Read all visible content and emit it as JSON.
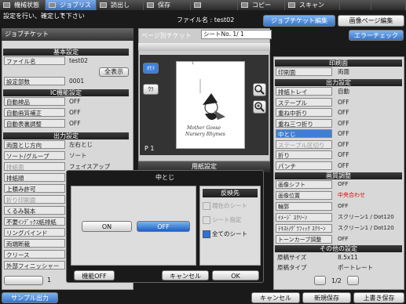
{
  "tabs": [
    "機械状態",
    "ジョブリスト",
    "読出し",
    "保存",
    "コピー",
    "スキャン"
  ],
  "status_line": "設定を行い、確定して下さい",
  "file_label": "ファイル名 : test02",
  "left": {
    "title": "ジョブチケット",
    "basic_hdr": "基本設定",
    "file_name_label": "ファイル名",
    "file_name_value": "test02",
    "show_all": "全表示",
    "copies_label": "設定部数",
    "copies_value": "0001",
    "ic_hdr": "IC機能設定",
    "ic_rows": [
      {
        "l": "自動検品",
        "v": "OFF"
      },
      {
        "l": "自動画質補正",
        "v": "OFF"
      },
      {
        "l": "自動表裏調整",
        "v": "OFF"
      }
    ],
    "out_hdr": "出力設定",
    "out_rows": [
      {
        "l": "両面とじ方向",
        "v": "左右とじ"
      },
      {
        "l": "ソート/グループ",
        "v": "ソート"
      },
      {
        "l": "排紙面",
        "v": "フェイスアップ"
      },
      {
        "l": "排紙順",
        "v": ""
      },
      {
        "l": "上積み許可",
        "v": ""
      },
      {
        "l": "折り印刷面",
        "v": ""
      },
      {
        "l": "くるみ製本",
        "v": ""
      },
      {
        "l": "不要ｲﾝﾃﾞｯｸｽ紙排紙",
        "v": ""
      },
      {
        "l": "リングバインド",
        "v": ""
      },
      {
        "l": "両端断裁",
        "v": ""
      },
      {
        "l": "クリース",
        "v": ""
      },
      {
        "l": "外部フィニッシャー",
        "v": ""
      }
    ],
    "page": "1"
  },
  "mid": {
    "title": "ページ別チケット",
    "sheet_label": "シートNo.",
    "sheet_value": "1/  1",
    "omote": "ｵﾓﾃ",
    "ura": "ｳﾗ",
    "page_label": "P 1",
    "paper_hdr": "用紙設定",
    "doc_line1": "Mother Goose",
    "doc_line2": "Nursery Rhymes",
    "doc_num": "1"
  },
  "right": {
    "error_check": "エラーチェック",
    "print_hdr": "印刷面",
    "print_l": "印刷面",
    "print_v": "両面",
    "out_hdr": "出力設定",
    "out_rows": [
      {
        "l": "排紙トレイ",
        "v": "自動",
        "s": ""
      },
      {
        "l": "ステープル",
        "v": "OFF",
        "s": ""
      },
      {
        "l": "重ね中折り",
        "v": "OFF",
        "s": ""
      },
      {
        "l": "重ね三つ折り",
        "v": "OFF",
        "s": ""
      },
      {
        "l": "中とじ",
        "v": "OFF",
        "s": "blue"
      },
      {
        "l": "ステープル区切り",
        "v": "OFF",
        "s": "dis"
      },
      {
        "l": "折り",
        "v": "OFF",
        "s": ""
      },
      {
        "l": "パンチ",
        "v": "OFF",
        "s": ""
      }
    ],
    "img_hdr": "画質調整",
    "img_rows": [
      {
        "l": "画像シフト",
        "v": "OFF",
        "r": false
      },
      {
        "l": "画像位置",
        "v": "中央合わせ",
        "r": true
      },
      {
        "l": "輪郭",
        "v": "OFF",
        "r": false
      },
      {
        "l": "ｲﾒｰｼﾞ ｽｸﾘｰﾝ",
        "v": "スクリーン1 / Dot120",
        "r": false
      },
      {
        "l": "ﾃｷｽﾄ/ｸﾞﾗﾌｨｯｸ ｽｸﾘｰﾝ",
        "v": "スクリーン1 / Dot120",
        "r": false
      },
      {
        "l": "トーンカーブ調整",
        "v": "OFF",
        "r": false
      }
    ],
    "other_hdr": "その他の設定",
    "other_rows": [
      {
        "l": "原稿サイズ",
        "v": "8.5x11"
      },
      {
        "l": "原稿タイプ",
        "v": "ポートレート"
      }
    ],
    "page": "1/2"
  },
  "top_buttons": {
    "jobticket_edit": "ジョブチケット編集",
    "image_edit": "画像ページ編集"
  },
  "dialog": {
    "title": "中とじ",
    "on": "ON",
    "off": "OFF",
    "reflect": "反映先",
    "opt1": "現在のシート",
    "opt2": "シート指定",
    "opt3": "全てのシート",
    "func_off": "機能OFF",
    "cancel": "キャンセル",
    "ok": "OK"
  },
  "bottom": {
    "sample": "サンプル出力",
    "cancel": "キャンセル",
    "new_save": "新規保存",
    "overwrite": "上書き保存"
  }
}
